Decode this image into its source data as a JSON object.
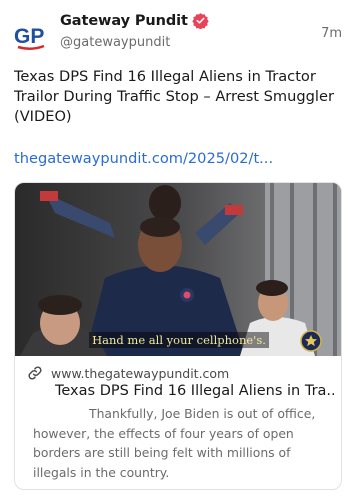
{
  "post": {
    "author_name": "Gateway Pundit",
    "handle": "@gatewaypundit",
    "time": "7m",
    "avatar_text": "GP",
    "text": "Texas DPS Find 16 Illegal Aliens in Tractor Trailor During Traffic Stop – Arrest Smuggler (VIDEO)",
    "link_text": "thegatewaypundit.com/2025/02/t..."
  },
  "card": {
    "video_caption": "Hand me all your cellphone's.",
    "domain": "www.thegatewaypundit.com",
    "title": "Texas DPS Find 16 Illegal Aliens in Tra...",
    "description": "Thankfully, Joe Biden is out of office, however, the effects of four years of open borders are still being felt with millions of illegals in the country."
  },
  "icons": {
    "verified": "verified-badge-icon",
    "link": "link-icon"
  },
  "colors": {
    "link": "#2a6bd6",
    "verified": "#e8435a",
    "avatar_blue": "#1f4f9e",
    "avatar_red": "#d42a2a"
  }
}
